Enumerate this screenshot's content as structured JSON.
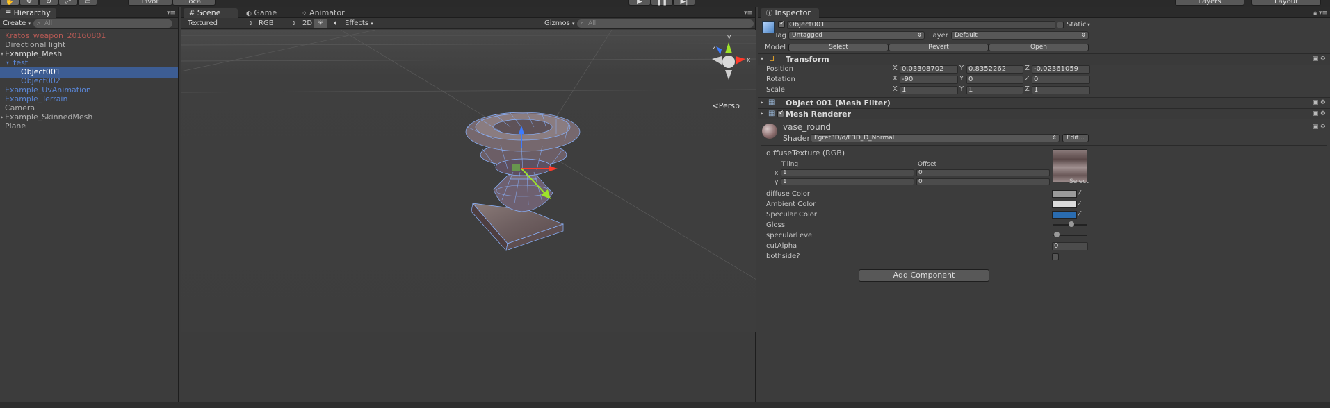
{
  "toolbar": {
    "pivot_label": "Pivot",
    "local_label": "Local",
    "layers_label": "Layers",
    "layout_label": "Layout"
  },
  "hierarchy": {
    "tab_label": "Hierarchy",
    "create_label": "Create",
    "search_placeholder": "All",
    "items": [
      {
        "label": "Kratos_weapon_20160801",
        "color": "#b85a55"
      },
      {
        "label": "Directional light",
        "color": "#b0b0b0"
      },
      {
        "label": "Example_Mesh",
        "color": "#d8d8d8"
      },
      {
        "label": "test",
        "color": "#5a86d6"
      },
      {
        "label": "Object001",
        "color": "#ffffff"
      },
      {
        "label": "Object002",
        "color": "#5a86d6"
      },
      {
        "label": "Example_UvAnimation",
        "color": "#5a86d6"
      },
      {
        "label": "Example_Terrain",
        "color": "#5a86d6"
      },
      {
        "label": "Camera",
        "color": "#b0b0b0"
      },
      {
        "label": "Example_SkinnedMesh",
        "color": "#b0b0b0"
      },
      {
        "label": "Plane",
        "color": "#b0b0b0"
      }
    ]
  },
  "scene": {
    "tabs": [
      "Scene",
      "Game",
      "Animator"
    ],
    "shading_mode": "Textured",
    "render_mode": "RGB",
    "mode_2d": "2D",
    "effects_label": "Effects",
    "gizmos_label": "Gizmos",
    "search_placeholder": "All",
    "persp_label": "Persp",
    "gizmo_axes": {
      "x": "x",
      "y": "y",
      "z": "z"
    }
  },
  "inspector": {
    "tab_label": "Inspector",
    "object_name": "Object001",
    "static_label": "Static",
    "tag_label": "Tag",
    "tag_value": "Untagged",
    "layer_label": "Layer",
    "layer_value": "Default",
    "model_label": "Model",
    "model_buttons": [
      "Select",
      "Revert",
      "Open"
    ],
    "transform": {
      "title": "Transform",
      "position_label": "Position",
      "rotation_label": "Rotation",
      "scale_label": "Scale",
      "position": {
        "x": "0.03308702",
        "y": "0.8352262",
        "z": "-0.02361059"
      },
      "rotation": {
        "x": "-90",
        "y": "0",
        "z": "0"
      },
      "scale": {
        "x": "1",
        "y": "1",
        "z": "1"
      }
    },
    "mesh_filter_title": "Object 001 (Mesh Filter)",
    "mesh_renderer_title": "Mesh Renderer",
    "material": {
      "name": "vase_round",
      "shader_label": "Shader",
      "shader_value": "Egret3D/d/E3D_D_Normal",
      "edit_label": "Edit...",
      "texture_label": "diffuseTexture (RGB)",
      "tiling_label": "Tiling",
      "offset_label": "Offset",
      "tiling_x": "1",
      "tiling_y": "1",
      "offset_x": "0",
      "offset_y": "0",
      "select_label": "Select",
      "diffuse_color_label": "diffuse Color",
      "ambient_color_label": "Ambient Color",
      "specular_color_label": "Specular Color",
      "gloss_label": "Gloss",
      "specular_level_label": "specularLevel",
      "cut_alpha_label": "cutAlpha",
      "cut_alpha_value": "0",
      "bothside_label": "bothside?",
      "diffuse_color": "#9a9a9a",
      "ambient_color": "#dcdcdc",
      "specular_color": "#2a6cb0",
      "gloss_level": 0.55,
      "specular_level": 0.05
    },
    "add_component_label": "Add Component"
  }
}
